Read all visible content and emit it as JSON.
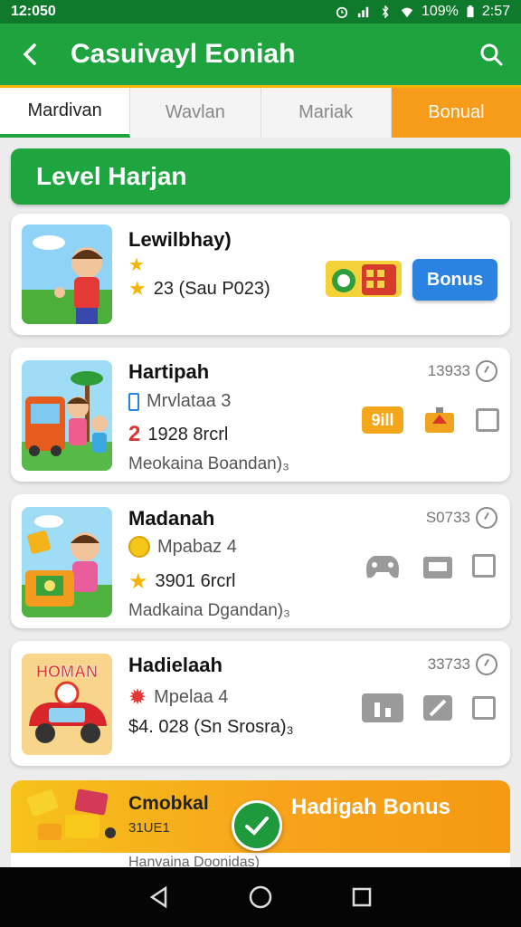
{
  "status": {
    "time": "12:050",
    "battery": "109%",
    "clock_right": "2:57"
  },
  "appbar": {
    "title": "Casuivayl Eoniah"
  },
  "tabs": [
    {
      "label": "Mardivan"
    },
    {
      "label": "Wavlan"
    },
    {
      "label": "Mariak"
    },
    {
      "label": "Bonual"
    }
  ],
  "banner": {
    "title": "Level Harjan"
  },
  "cards": [
    {
      "name": "Lewilbhay)",
      "line1": "",
      "line2": "23 (Sau P023)",
      "button": "Bonus"
    },
    {
      "name": "Hartipah",
      "meta": "13933",
      "line1": "Mrvlataa 3",
      "line1_prefix": "",
      "line2_prefix": "2",
      "line2": "1928 8rcrl",
      "sub": "Meokaina Boandan)₃",
      "badge": "9ill"
    },
    {
      "name": "Madanah",
      "meta": "S0733",
      "line1": "Mpabaz 4",
      "line2": "3901 6rcrl",
      "sub": "Madkaina Dgandan)₃"
    },
    {
      "name": "Hadielaah",
      "meta": "33733",
      "line1": "Mpelaa 4",
      "line2": "$4. 028 (Sn Srosra)₃",
      "thumb_label": "HOMAN"
    }
  ],
  "promo": {
    "left_title": "Cmobkal",
    "left_sub": "31UE1",
    "right_title": "Hadigah Bonus",
    "bottom_text": "Hanvaina Doonidas)"
  },
  "colors": {
    "primary": "#1ea33f",
    "accent": "#f79b1b",
    "button": "#2a83e0"
  }
}
